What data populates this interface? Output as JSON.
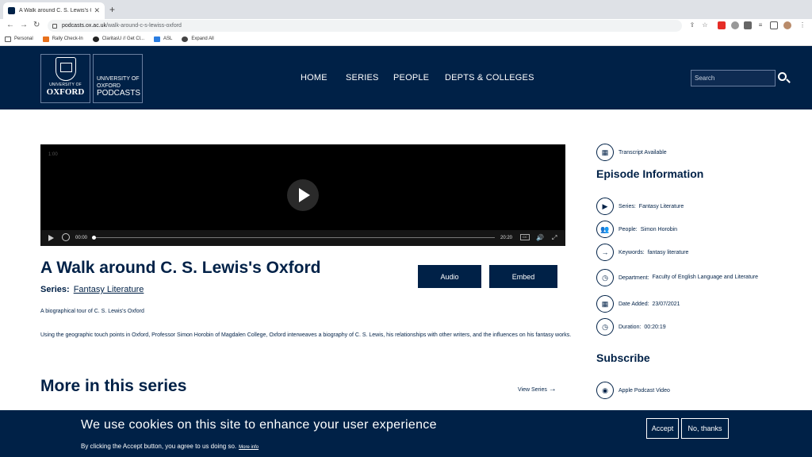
{
  "browser": {
    "tab_title": "A Walk around C. S. Lewis's Ox",
    "url_host": "podcasts.ox.ac.uk",
    "url_path": "/walk-around-c-s-lewiss-oxford",
    "bookmarks": [
      "Personal",
      "Rally Check-In",
      "ClaritasU // Get Cl...",
      "ASL",
      "Expand All"
    ]
  },
  "header": {
    "logo_university": "UNIVERSITY OF",
    "logo_oxford": "OXFORD",
    "logo2_line1": "UNIVERSITY OF",
    "logo2_line2": "OXFORD",
    "logo2_line3": "PODCASTS",
    "nav": [
      "HOME",
      "SERIES",
      "PEOPLE",
      "DEPTS & COLLEGES"
    ],
    "search_placeholder": "Search"
  },
  "player": {
    "hover_time": "1:00",
    "current": "00:00",
    "duration": "20:20",
    "cc": "CC",
    "progress": 0
  },
  "episode": {
    "title": "A Walk around C. S. Lewis's Oxford",
    "series_label": "Series:",
    "series_value": "Fantasy Literature",
    "audio_button": "Audio",
    "embed_button": "Embed",
    "short_desc": "A biographical tour of C. S. Lewis's Oxford",
    "long_desc": "Using the geographic touch points in Oxford, Professor Simon Horobin of Magdalen College, Oxford interweaves a biography of C. S. Lewis, his relationships with other writers, and the influences on his fantasy works.",
    "more_heading": "More in this series",
    "view_series": "View Series"
  },
  "sidebar": {
    "transcript": "Transcript Available",
    "info_heading": "Episode Information",
    "series_label": "Series:",
    "series_value": "Fantasy Literature",
    "people_label": "People:",
    "people_value": "Simon Horobin",
    "keywords_label": "Keywords:",
    "keywords_value": "fantasy literature",
    "dept_label": "Department:",
    "dept_value": "Faculty of English Language and Literature",
    "date_label": "Date Added:",
    "date_value": "23/07/2021",
    "duration_label": "Duration:",
    "duration_value": "00:20:19",
    "subscribe_heading": "Subscribe",
    "apple": "Apple Podcast Video"
  },
  "cookie": {
    "heading": "We use cookies on this site to enhance your user experience",
    "sub": "By clicking the Accept button, you agree to us doing so.",
    "more_info": "More info",
    "accept": "Accept",
    "decline": "No, thanks"
  }
}
